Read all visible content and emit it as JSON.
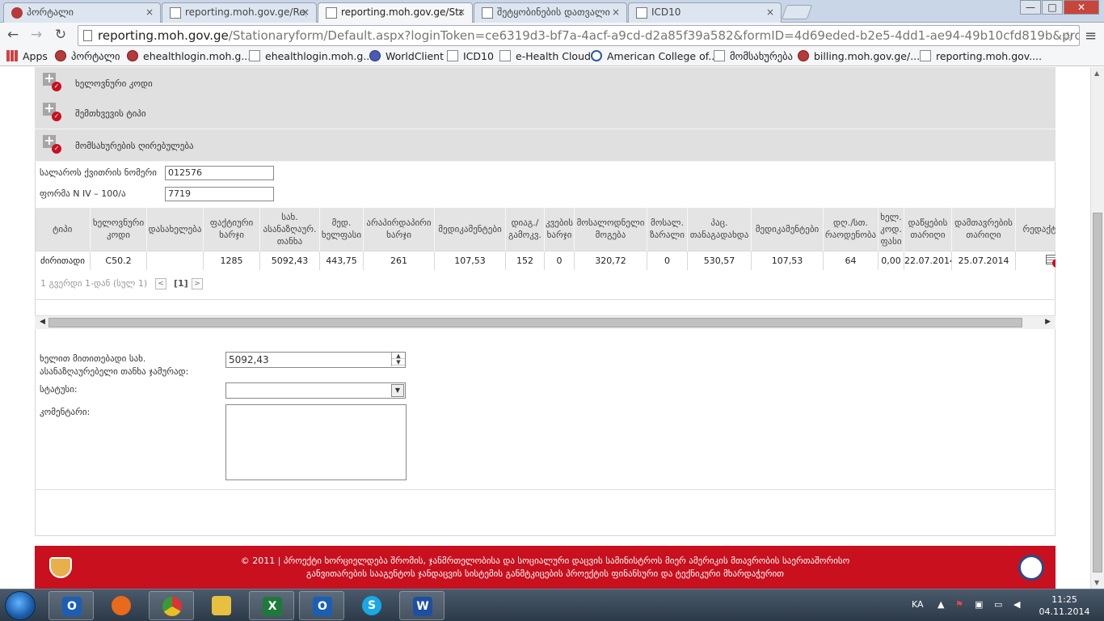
{
  "browser": {
    "tabs": [
      {
        "title": "პორტალი",
        "active": false
      },
      {
        "title": "reporting.moh.gov.ge/Rep",
        "active": false
      },
      {
        "title": "reporting.moh.gov.ge/Sta",
        "active": true
      },
      {
        "title": "შეტყობინების დათვალი",
        "active": false
      },
      {
        "title": "ICD10",
        "active": false
      }
    ],
    "tab_close": "×",
    "window_buttons": {
      "minimize": "—",
      "maximize": "□",
      "close": "✕"
    },
    "url_host": "reporting.moh.gov.ge",
    "url_path": "/Stationaryform/Default.aspx?loginToken=ce6319d3-bf7a-4acf-a9cd-d2a85f39a582&formID=4d69eded-b2e5-4dd1-ae94-49b10cfd819b&providerII",
    "bookmarks": [
      {
        "label": "Apps"
      },
      {
        "label": "პორტალი"
      },
      {
        "label": "ehealthlogin.moh.g..."
      },
      {
        "label": "ehealthlogin.moh.g..."
      },
      {
        "label": "WorldClient"
      },
      {
        "label": "ICD10"
      },
      {
        "label": "e-Health Cloud"
      },
      {
        "label": "American College of..."
      },
      {
        "label": "მომსახურება"
      },
      {
        "label": "billing.moh.gov.ge/..."
      },
      {
        "label": "reporting.moh.gov...."
      }
    ]
  },
  "accordion": [
    {
      "label": "ხელოვნური კოდი"
    },
    {
      "label": "შემთხვევის ტიპი"
    },
    {
      "label": "მომსახურების ღირებულება"
    }
  ],
  "form": {
    "ticket_label": "სალაროს ქვითრის ნომერი",
    "ticket_value": "012576",
    "form_label": "ფორმა N IV – 100/ა",
    "form_value": "7719"
  },
  "grid": {
    "headers": [
      "ტიპი",
      "ხელოვნური კოდი",
      "დასახელება",
      "ფაქტიური ხარჯი",
      "სახ. ასანაზღაურ. თანხა",
      "მედ. ხელფასი",
      "არაპირდაპირი ხარჯი",
      "მედიკამენტები",
      "დიაგ./ გამოკვ.",
      "კვების ხარჯი",
      "მოსალოდნელი მოგება",
      "მოსალ. ზარალი",
      "პაც. თანაგადახდა",
      "მედიკამენტები",
      "დღ./სთ. რაოდენობა",
      "ხელ. კოდ. ფასი",
      "დაწყების თარიღი",
      "დამთავრების თარიღი",
      "რედაქტირება"
    ],
    "rows": [
      [
        "ძირითადი",
        "C50.2",
        "",
        "1285",
        "5092,43",
        "443,75",
        "261",
        "107,53",
        "152",
        "0",
        "320,72",
        "0",
        "530,57",
        "107,53",
        "64",
        "0,00",
        "22.07.2014",
        "25.07.2014"
      ]
    ],
    "pager_text": "1 გვერდი 1-დან (სულ 1)",
    "pager_prev": "<",
    "pager_next": ">",
    "pager_current": "[1]"
  },
  "summary": {
    "amount_label": "ხელით მითითებადი სახ. ასანაზღაურებელი თანხა ჯამურად:",
    "amount_value": "5092,43",
    "status_label": "სტატუსი:",
    "status_value": "",
    "comment_label": "კომენტარი:",
    "comment_value": ""
  },
  "footer": {
    "line1": "© 2011 | პროექტი ხორციელდება შრომის, ჯანმრთელობისა და სოციალური დაცვის სამინისტროს მიერ ამერიკის მთავრობის საერთაშორისო",
    "line2": "განვითარების სააგენტოს ჯანდაცვის სისტემის განმტკიცების პროექტის ფინანსური და ტექნიკური მხარდაჭერით"
  },
  "taskbar": {
    "apps": [
      {
        "name": "outlook",
        "letter": "O",
        "color": "#1a5fb4"
      },
      {
        "name": "firefox",
        "letter": "",
        "color": "#e86a1a"
      },
      {
        "name": "chrome",
        "letter": "",
        "color": "#3a9a3a"
      },
      {
        "name": "explorer",
        "letter": "",
        "color": "#e8c040"
      },
      {
        "name": "excel",
        "letter": "X",
        "color": "#1e7a3a"
      },
      {
        "name": "outlook2",
        "letter": "O",
        "color": "#1a5fb4"
      },
      {
        "name": "skype",
        "letter": "S",
        "color": "#19a8e6"
      },
      {
        "name": "word",
        "letter": "W",
        "color": "#1e4fa0"
      }
    ],
    "language": "KA",
    "time": "11:25",
    "date": "04.11.2014"
  }
}
